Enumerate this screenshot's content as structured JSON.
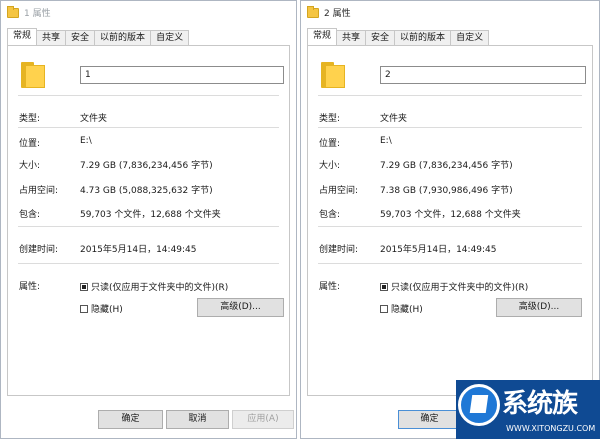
{
  "tabs": [
    "常规",
    "共享",
    "安全",
    "以前的版本",
    "自定义"
  ],
  "labels": {
    "type": "类型:",
    "location": "位置:",
    "size": "大小:",
    "size_on_disk": "占用空间:",
    "contains": "包含:",
    "created": "创建时间:",
    "attributes": "属性:"
  },
  "attr_options": {
    "readonly": "只读(仅应用于文件夹中的文件)(R)",
    "hidden": "隐藏(H)",
    "advanced": "高级(D)..."
  },
  "buttons": {
    "ok": "确定",
    "cancel": "取消",
    "apply": "应用(A)"
  },
  "window1": {
    "title": "1 属性",
    "name": "1",
    "type": "文件夹",
    "location": "E:\\",
    "size": "7.29 GB (7,836,234,456 字节)",
    "size_on_disk": "4.73 GB (5,088,325,632 字节)",
    "contains": "59,703 个文件，12,688 个文件夹",
    "created": "2015年5月14日，14:49:45"
  },
  "window2": {
    "title": "2 属性",
    "name": "2",
    "type": "文件夹",
    "location": "E:\\",
    "size": "7.29 GB (7,836,234,456 字节)",
    "size_on_disk": "7.38 GB (7,930,986,496 字节)",
    "contains": "59,703 个文件，12,688 个文件夹",
    "created": "2015年5月14日，14:49:45"
  },
  "watermark": {
    "text": "系统族",
    "url": "WWW.XITONGZU.COM"
  },
  "colors": {
    "folder": "#ffd24d",
    "logo_bg": "#0f4a93",
    "focus": "#4a8fd6"
  }
}
